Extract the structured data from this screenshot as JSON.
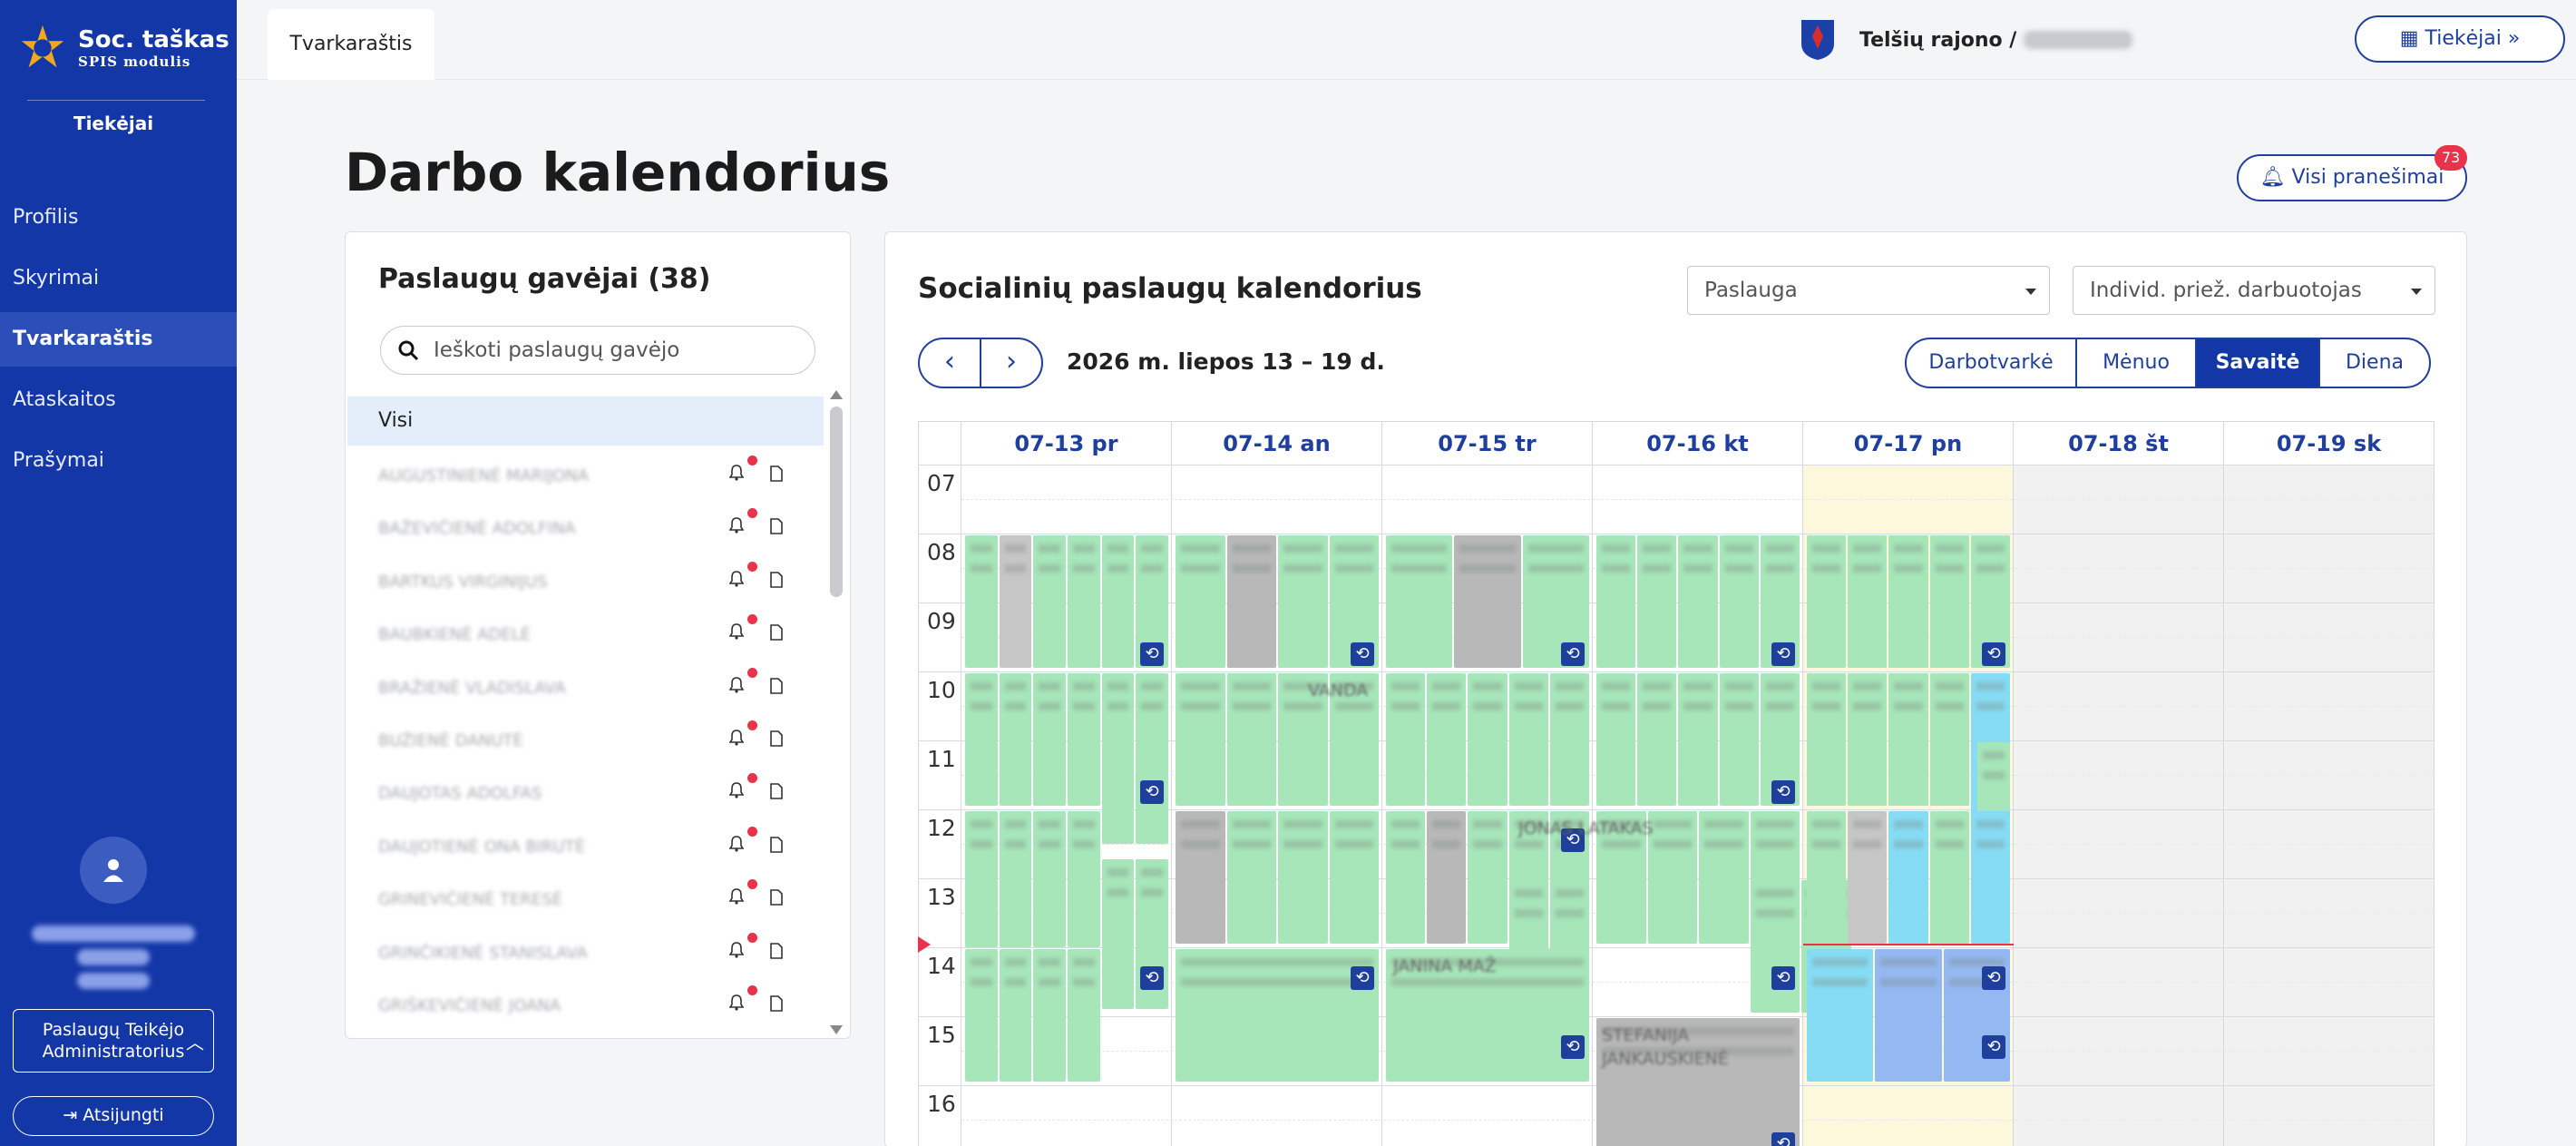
{
  "brand": {
    "title": "Soc. taškas",
    "subtitle": "SPIS modulis"
  },
  "sidebar": {
    "section_label": "Tiekėjai",
    "items": [
      {
        "label": "Profilis",
        "active": false
      },
      {
        "label": "Skyrimai",
        "active": false
      },
      {
        "label": "Tvarkaraštis",
        "active": true
      },
      {
        "label": "Ataskaitos",
        "active": false
      },
      {
        "label": "Prašymai",
        "active": false
      }
    ],
    "role": {
      "line1": "Paslaugų Teikėjo",
      "line2": "Administratorius"
    },
    "logout_label": "Atsijungti"
  },
  "topbar": {
    "tab_label": "Tvarkaraštis",
    "municipality": "Telšių rajono /",
    "supplier_button": "Tiekėjai"
  },
  "page": {
    "title": "Darbo kalendorius",
    "notifications_label": "Visi pranešimai",
    "notifications_count": "73"
  },
  "recipients": {
    "title": "Paslaugų gavėjai (38)",
    "search_placeholder": "Ieškoti paslaugų gavėjo",
    "all_label": "Visi",
    "names": [
      "AUGUSTINIENĖ MARIJONA",
      "BAŽEVIČIENĖ ADOLFINA",
      "BARTKUS VIRGINIJUS",
      "BAUBKIENĖ ADELĖ",
      "BRAŽIENĖ VLADISLAVA",
      "BUŽIENĖ DANUTĖ",
      "DAUJOTAS ADOLFAS",
      "DAUJOTIENĖ ONA BIRUTĖ",
      "GRINEVIČIENĖ TERESĖ",
      "GRINČIKIENĖ STANISLAVA",
      "GRIŠKEVIČIENĖ JOANA"
    ]
  },
  "calendar": {
    "title": "Socialinių paslaugų kalendorius",
    "service_select": "Paslauga",
    "worker_select": "Individ. priež. darbuotojas",
    "prev_label": "‹",
    "next_label": "›",
    "range": "2026 m. liepos 13 – 19 d.",
    "views": [
      {
        "label": "Darbotvarkė",
        "active": false
      },
      {
        "label": "Mėnuo",
        "active": false
      },
      {
        "label": "Savaitė",
        "active": true
      },
      {
        "label": "Diena",
        "active": false
      }
    ],
    "days": [
      "07-13 pr",
      "07-14 an",
      "07-15 tr",
      "07-16 kt",
      "07-17 pn",
      "07-18 št",
      "07-19 sk"
    ],
    "hours": [
      "07",
      "08",
      "09",
      "10",
      "11",
      "12",
      "13",
      "14",
      "15",
      "16"
    ],
    "event_labels": [
      "JANINA MAŽ",
      "STEFANIJA JANKAUSKIENĖ",
      "JONAS LATAKAS",
      "VANDA"
    ],
    "colors": {
      "green": "#a6e6b9",
      "gray": "#c6c6c6",
      "blue": "#86dcf5",
      "indigo": "#94b8f2",
      "today": "#fdf7dc",
      "weekend": "#f1f1f1",
      "accent": "#1f3f9c"
    }
  }
}
